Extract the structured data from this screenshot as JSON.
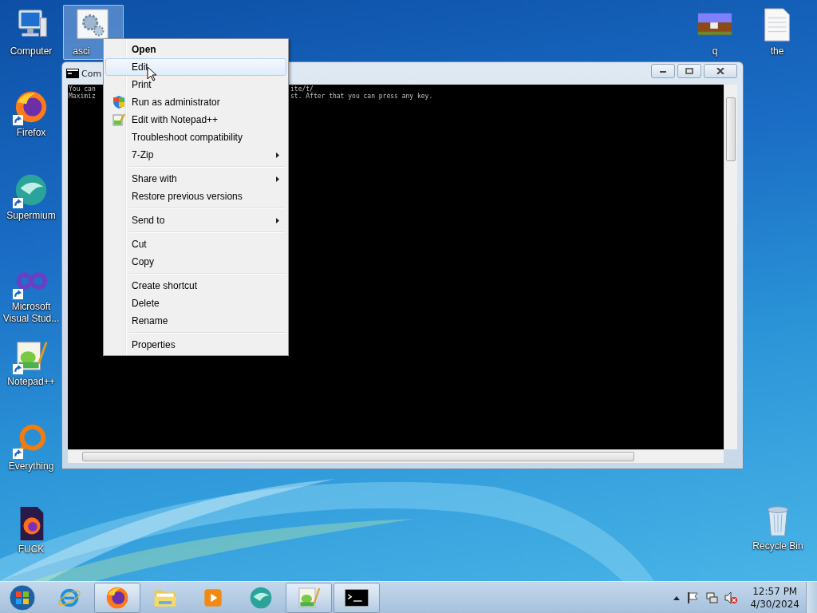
{
  "desktop_icons": [
    {
      "label": "Computer",
      "selected": false,
      "shortcut": false
    },
    {
      "label": "asci",
      "selected": true,
      "shortcut": false
    },
    {
      "label": "q",
      "selected": false,
      "shortcut": false
    },
    {
      "label": "the",
      "selected": false,
      "shortcut": false
    },
    {
      "label": "Firefox",
      "selected": false,
      "shortcut": true
    },
    {
      "label": "Supermium",
      "selected": false,
      "shortcut": true
    },
    {
      "label": "Microsoft Visual Stud...",
      "selected": false,
      "shortcut": true
    },
    {
      "label": "Notepad++",
      "selected": false,
      "shortcut": true
    },
    {
      "label": "Everything",
      "selected": false,
      "shortcut": true
    },
    {
      "label": "FUCK",
      "selected": false,
      "shortcut": false
    },
    {
      "label": "Recycle Bin",
      "selected": false,
      "shortcut": false
    }
  ],
  "console_window": {
    "title": "Com",
    "lines": [
      {
        "left": "You can",
        "right": "ite/t/"
      },
      {
        "left": "Maximiz",
        "right": "st. After that you can press any key."
      }
    ]
  },
  "context_menu": [
    {
      "kind": "item",
      "label": "Open",
      "default": true,
      "selected": false,
      "submenu": false
    },
    {
      "kind": "item",
      "label": "Edit",
      "default": false,
      "selected": true,
      "submenu": false
    },
    {
      "kind": "item",
      "label": "Print",
      "default": false,
      "selected": false,
      "submenu": false
    },
    {
      "kind": "item",
      "label": "Run as administrator",
      "default": false,
      "selected": false,
      "submenu": false
    },
    {
      "kind": "item",
      "label": "Edit with Notepad++",
      "default": false,
      "selected": false,
      "submenu": false
    },
    {
      "kind": "item",
      "label": "Troubleshoot compatibility",
      "default": false,
      "selected": false,
      "submenu": false
    },
    {
      "kind": "item",
      "label": "7-Zip",
      "default": false,
      "selected": false,
      "submenu": true
    },
    {
      "kind": "separator"
    },
    {
      "kind": "item",
      "label": "Share with",
      "default": false,
      "selected": false,
      "submenu": true
    },
    {
      "kind": "item",
      "label": "Restore previous versions",
      "default": false,
      "selected": false,
      "submenu": false
    },
    {
      "kind": "separator"
    },
    {
      "kind": "item",
      "label": "Send to",
      "default": false,
      "selected": false,
      "submenu": true
    },
    {
      "kind": "separator"
    },
    {
      "kind": "item",
      "label": "Cut",
      "default": false,
      "selected": false,
      "submenu": false
    },
    {
      "kind": "item",
      "label": "Copy",
      "default": false,
      "selected": false,
      "submenu": false
    },
    {
      "kind": "separator"
    },
    {
      "kind": "item",
      "label": "Create shortcut",
      "default": false,
      "selected": false,
      "submenu": false
    },
    {
      "kind": "item",
      "label": "Delete",
      "default": false,
      "selected": false,
      "submenu": false
    },
    {
      "kind": "item",
      "label": "Rename",
      "default": false,
      "selected": false,
      "submenu": false
    },
    {
      "kind": "separator"
    },
    {
      "kind": "item",
      "label": "Properties",
      "default": false,
      "selected": false,
      "submenu": false
    }
  ],
  "taskbar": {
    "buttons": [
      {
        "running": false
      },
      {
        "running": true
      },
      {
        "running": false
      },
      {
        "running": false
      },
      {
        "running": false
      },
      {
        "running": true
      },
      {
        "running": true
      }
    ],
    "clock": {
      "time": "12:57 PM",
      "date": "4/30/2024"
    }
  }
}
